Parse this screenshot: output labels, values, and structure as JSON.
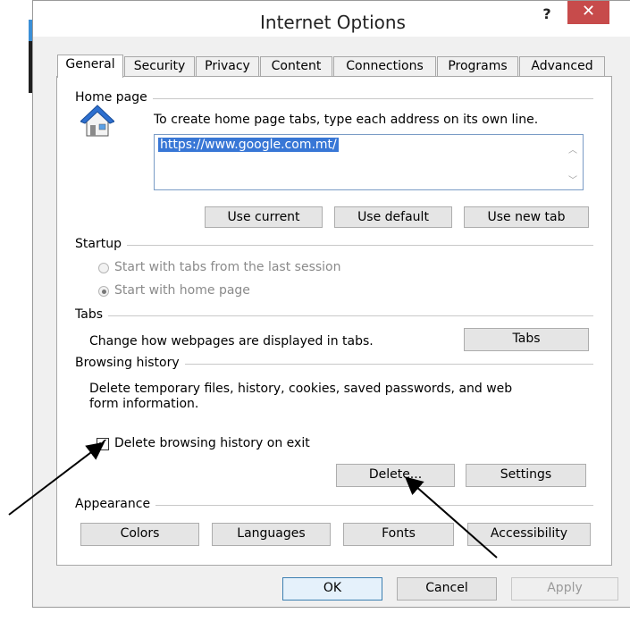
{
  "window": {
    "title": "Internet Options",
    "help_label": "?",
    "close_label": "✕"
  },
  "tabs": [
    {
      "label": "General",
      "active": true
    },
    {
      "label": "Security"
    },
    {
      "label": "Privacy"
    },
    {
      "label": "Content"
    },
    {
      "label": "Connections"
    },
    {
      "label": "Programs"
    },
    {
      "label": "Advanced"
    }
  ],
  "home_page": {
    "group_label": "Home page",
    "instruction": "To create home page tabs, type each address on its own line.",
    "value": "https://www.google.com.mt/",
    "buttons": {
      "use_current": "Use current",
      "use_default": "Use default",
      "use_new_tab": "Use new tab"
    }
  },
  "startup": {
    "group_label": "Startup",
    "option_last_session": "Start with tabs from the last session",
    "option_home_page": "Start with home page"
  },
  "tabs_group": {
    "group_label": "Tabs",
    "description": "Change how webpages are displayed in tabs.",
    "button": "Tabs"
  },
  "browsing_history": {
    "group_label": "Browsing history",
    "description_line1": "Delete temporary files, history, cookies, saved passwords, and web",
    "description_line2": "form information.",
    "checkbox_label": "Delete browsing history on exit",
    "checkbox_checked": true,
    "delete_button": "Delete...",
    "settings_button": "Settings"
  },
  "appearance": {
    "group_label": "Appearance",
    "colors": "Colors",
    "languages": "Languages",
    "fonts": "Fonts",
    "accessibility": "Accessibility"
  },
  "footer": {
    "ok": "OK",
    "cancel": "Cancel",
    "apply": "Apply"
  },
  "colors": {
    "close_button": "#c74b4b",
    "selection": "#3877d6",
    "ok_border": "#3c7fb1"
  }
}
